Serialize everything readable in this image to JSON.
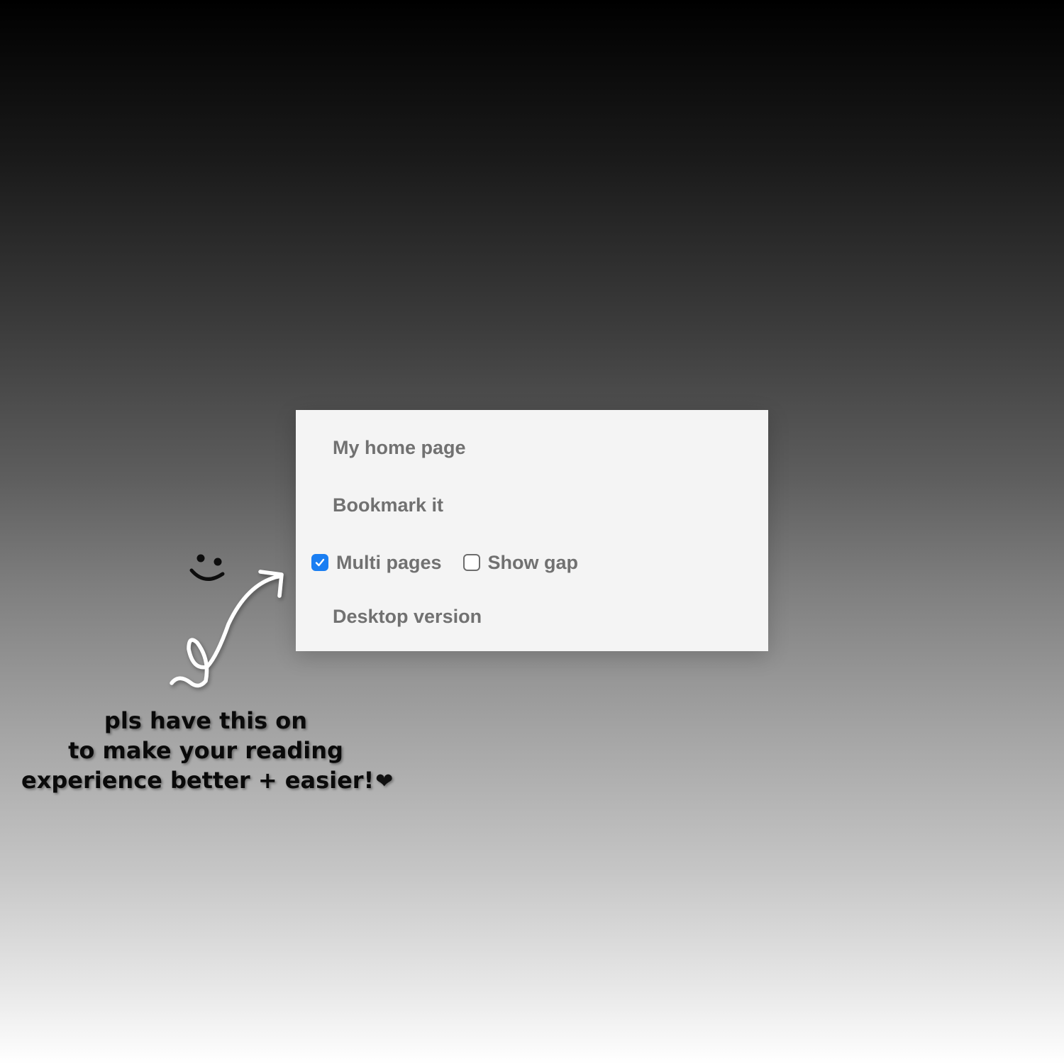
{
  "menu": {
    "items": [
      {
        "label": "My home page"
      },
      {
        "label": "Bookmark it"
      },
      {
        "label": "Desktop version"
      }
    ],
    "options": {
      "multi_pages": {
        "label": "Multi pages",
        "checked": true
      },
      "show_gap": {
        "label": "Show gap",
        "checked": false
      }
    }
  },
  "annotation": {
    "caption_lines": [
      "pls have this on",
      "to make your reading",
      "experience better + easier!"
    ],
    "heart_icon": "heart-icon",
    "smiley_icon": "smiley-face-icon",
    "arrow_icon": "curly-arrow-icon"
  },
  "colors": {
    "checkbox_accent": "#1a7ef2",
    "menu_text": "#717171",
    "menu_background": "#f4f4f4"
  }
}
